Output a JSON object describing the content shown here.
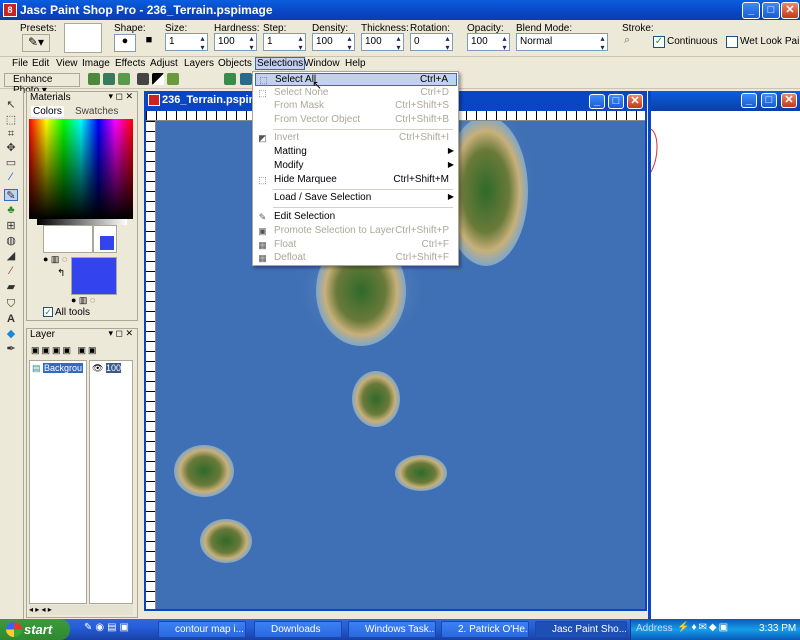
{
  "app": {
    "title": "Jasc Paint Shop Pro - 236_Terrain.pspimage"
  },
  "options": {
    "presets": "Presets:",
    "shape": "Shape:",
    "size_label": "Size:",
    "size": "1",
    "hardness_label": "Hardness:",
    "hardness": "100",
    "step_label": "Step:",
    "step": "1",
    "density_label": "Density:",
    "density": "100",
    "thickness_label": "Thickness:",
    "thickness": "100",
    "rotation_label": "Rotation:",
    "rotation": "0",
    "opacity_label": "Opacity:",
    "opacity": "100",
    "blend_label": "Blend Mode:",
    "blend": "Normal",
    "stroke_label": "Stroke:",
    "continuous": "Continuous",
    "wetlook": "Wet Look Pai"
  },
  "menubar": [
    "File",
    "Edit",
    "View",
    "Image",
    "Effects",
    "Adjust",
    "Layers",
    "Objects",
    "Selections",
    "Window",
    "Help"
  ],
  "toolbar2": {
    "enhance": "Enhance Photo"
  },
  "materials": {
    "title": "Materials",
    "tab_colors": "Colors",
    "tab_swatches": "Swatches",
    "all_tools": "All tools"
  },
  "layer": {
    "title": "Layer",
    "name": "Backgrou",
    "opacity": "100"
  },
  "canvas": {
    "title": "236_Terrain.pspima"
  },
  "selections_menu": [
    {
      "label": "Select All",
      "shortcut": "Ctrl+A",
      "state": "highlight"
    },
    {
      "label": "Select None",
      "shortcut": "Ctrl+D",
      "state": "disabled"
    },
    {
      "label": "From Mask",
      "shortcut": "Ctrl+Shift+S",
      "state": "disabled"
    },
    {
      "label": "From Vector Object",
      "shortcut": "Ctrl+Shift+B",
      "state": "disabled"
    },
    {
      "label": "Invert",
      "shortcut": "Ctrl+Shift+I",
      "state": "disabled"
    },
    {
      "label": "Matting",
      "shortcut": "",
      "state": "submenu"
    },
    {
      "label": "Modify",
      "shortcut": "",
      "state": "submenu"
    },
    {
      "label": "Hide Marquee",
      "shortcut": "Ctrl+Shift+M",
      "state": "normal"
    },
    {
      "label": "Load / Save Selection",
      "shortcut": "",
      "state": "submenu"
    },
    {
      "label": "Edit Selection",
      "shortcut": "",
      "state": "normal"
    },
    {
      "label": "Promote Selection to Layer",
      "shortcut": "Ctrl+Shift+P",
      "state": "disabled"
    },
    {
      "label": "Float",
      "shortcut": "Ctrl+F",
      "state": "disabled"
    },
    {
      "label": "Defloat",
      "shortcut": "Ctrl+Shift+F",
      "state": "disabled"
    }
  ],
  "taskbar": {
    "start": "start",
    "items": [
      "contour map i...",
      "Downloads",
      "Windows Task...",
      "2. Patrick O'He...",
      "Jasc Paint Sho..."
    ],
    "address": "Address",
    "clock": "3:33 PM"
  },
  "colors": {
    "xp_blue": "#0846c4",
    "ocean": "#3f6fb4",
    "menu_highlight": "#c1d2ee",
    "foreground": "#ffffff",
    "background": "#3344ee"
  }
}
